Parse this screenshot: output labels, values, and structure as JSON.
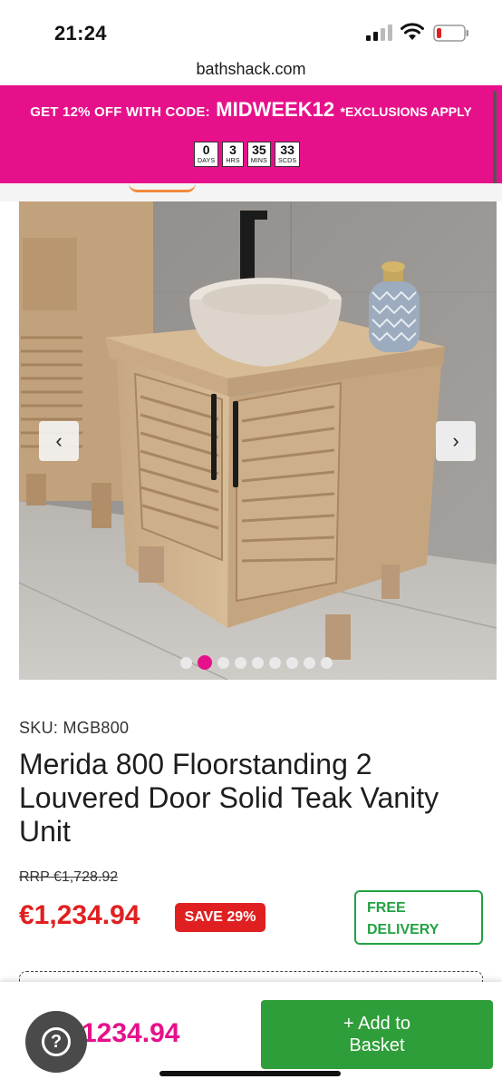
{
  "status": {
    "time": "21:24"
  },
  "browser": {
    "url": "bathshack.com"
  },
  "promo": {
    "text": "GET 12% OFF WITH CODE:",
    "code": "MIDWEEK12",
    "exclusions": "*EXCLUSIONS APPLY",
    "countdown": [
      {
        "value": "0",
        "label": "DAYS"
      },
      {
        "value": "3",
        "label": "HRS"
      },
      {
        "value": "35",
        "label": "MINS"
      },
      {
        "value": "33",
        "label": "SCDS"
      }
    ]
  },
  "gallery": {
    "image_count": 9,
    "active_index": 1,
    "prev_icon": "chevron-left-icon",
    "next_icon": "chevron-right-icon"
  },
  "product": {
    "sku": "SKU: MGB800",
    "title": "Merida 800 Floorstanding 2 Louvered Door Solid Teak Vanity Unit",
    "rrp": "RRP €1,728.92",
    "price": "€1,234.94",
    "save": "SAVE 29%",
    "delivery": "FREE DELIVERY"
  },
  "sticky": {
    "price": "1234.94",
    "add_label_line1": "+ Add to",
    "add_label_line2": "Basket",
    "help_icon": "question-mark-icon"
  },
  "colors": {
    "brand_pink": "#e6118a",
    "sale_red": "#e02020",
    "green": "#2e9e3a"
  }
}
